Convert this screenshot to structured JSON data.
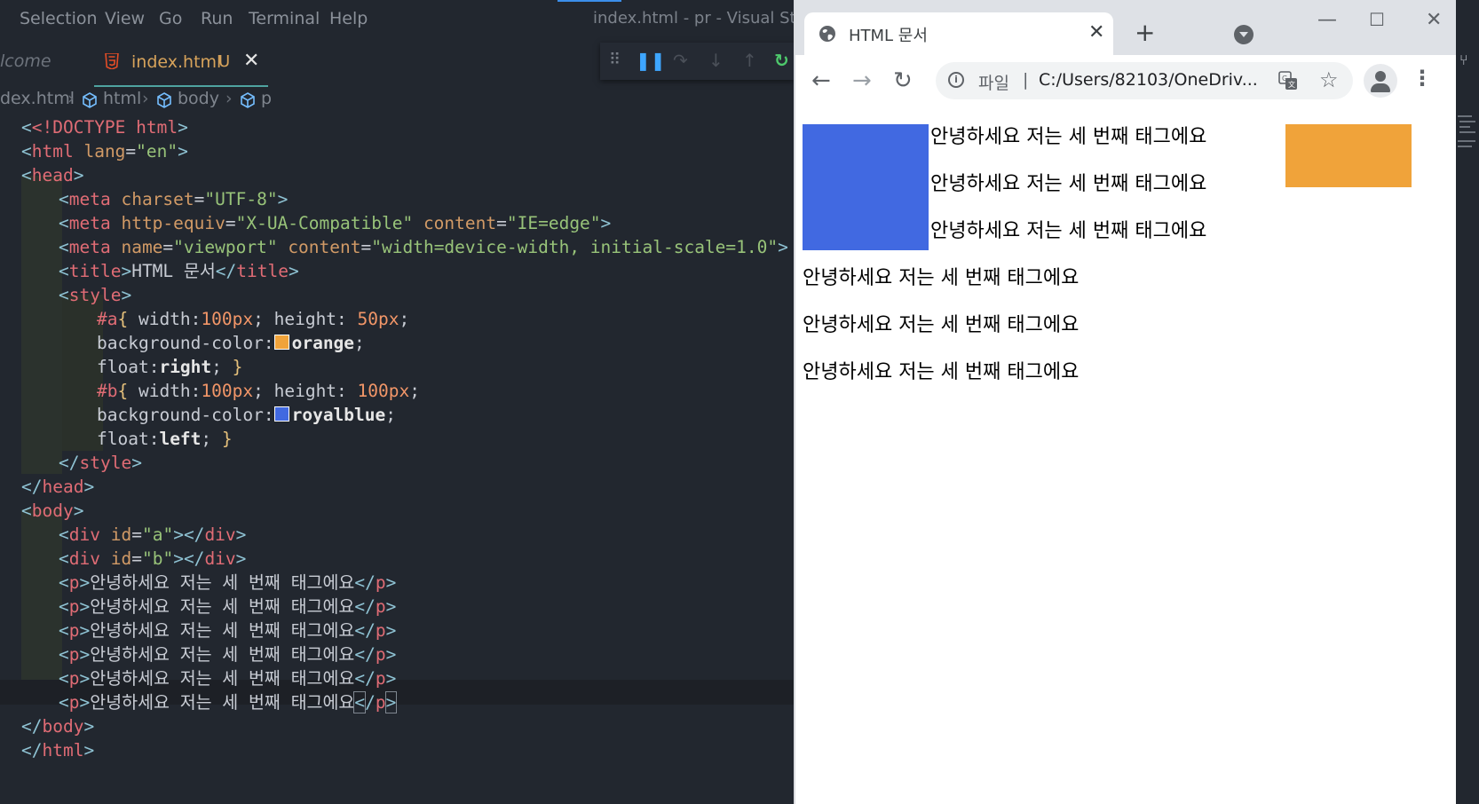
{
  "vscode": {
    "menu": [
      "Selection",
      "View",
      "Go",
      "Run",
      "Terminal",
      "Help"
    ],
    "window_title": "index.html - pr - Visual Studi",
    "tabs": {
      "welcome_label": "lcome",
      "active_label": "index.html",
      "active_status": "U",
      "close_glyph": "✕"
    },
    "breadcrumb": [
      "dex.html",
      "html",
      "body",
      "p"
    ],
    "style_values": {
      "orange_color": "#f0a33a",
      "royalblue_color": "#4169e1"
    }
  },
  "code": {
    "l1_a": "<!DOCTYPE ",
    "l1_b": "html",
    "l1_c": ">",
    "l2_tag": "html",
    "l2_attr": " lang",
    "l2_val": "\"en\"",
    "l3_tag": "head",
    "l4_tag": "meta",
    "l4_attr": " charset",
    "l4_val": "\"UTF-8\"",
    "l5_tag": "meta",
    "l5_attr1": " http-equiv",
    "l5_val1": "\"X-UA-Compatible\"",
    "l5_attr2": " content",
    "l5_val2": "\"IE=edge\"",
    "l6_tag": "meta",
    "l6_attr1": " name",
    "l6_val1": "\"viewport\"",
    "l6_attr2": " content",
    "l6_val2": "\"width=device-width, initial-scale=1.0\"",
    "l7_tag": "title",
    "l7_text": "HTML 문서",
    "l7_close": "title",
    "l8_tag": "style",
    "l9_sel": "#a",
    "l9_p1": " width:",
    "l9_n1": "100px",
    "l9_p2": "; height: ",
    "l9_n2": "50px",
    "l9_end": ";",
    "l10_prop": "background-color:",
    "l10_val": "orange",
    "l10_end": ";",
    "l11_prop": "float:",
    "l11_val": "right",
    "l11_end": "; ",
    "l12_sel": "#b",
    "l12_p1": " width:",
    "l12_n1": "100px",
    "l12_p2": "; height: ",
    "l12_n2": "100px",
    "l12_end": ";",
    "l13_prop": "background-color:",
    "l13_val": "royalblue",
    "l13_end": ";",
    "l14_prop": "float:",
    "l14_val": "left",
    "l14_end": "; ",
    "l15_tag": "style",
    "l16_tag": "head",
    "l17_tag": "body",
    "l18_tag": "div",
    "l18_attr": " id",
    "l18_val": "\"a\"",
    "l18_close": "div",
    "l19_tag": "div",
    "l19_attr": " id",
    "l19_val": "\"b\"",
    "l19_close": "div",
    "p_tag": "p",
    "p_text": "안녕하세요 저는 세 번째 태그에요",
    "l26_tag": "body",
    "l27_tag": "html"
  },
  "chrome": {
    "tab_title": "HTML 문서",
    "tab_close": "✕",
    "new_tab": "+",
    "scheme_label": "파일",
    "url": "C:/Users/82103/OneDriv...",
    "paragraphs": [
      "안녕하세요 저는 세 번째 태그에요",
      "안녕하세요 저는 세 번째 태그에요",
      "안녕하세요 저는 세 번째 태그에요",
      "안녕하세요 저는 세 번째 태그에요",
      "안녕하세요 저는 세 번째 태그에요",
      "안녕하세요 저는 세 번째 태그에요"
    ],
    "box_a_color": "#f0a33a",
    "box_b_color": "#4169e1"
  }
}
